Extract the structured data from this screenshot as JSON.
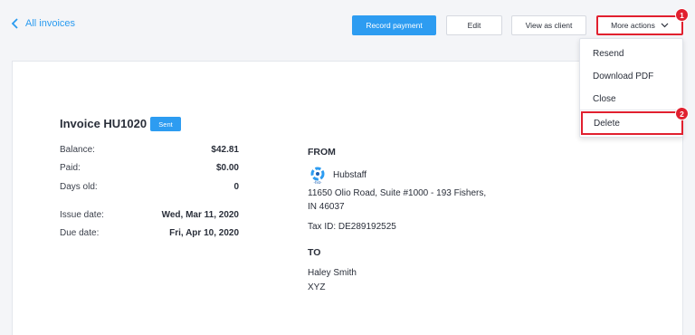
{
  "nav": {
    "back_label": "All invoices"
  },
  "toolbar": {
    "record_payment": "Record payment",
    "edit": "Edit",
    "view_as_client": "View as client",
    "more_actions": "More actions"
  },
  "annotations": {
    "badge_1": "1",
    "badge_2": "2"
  },
  "more_menu": {
    "items": [
      "Resend",
      "Download PDF",
      "Close",
      "Delete"
    ]
  },
  "invoice": {
    "title": "Invoice HU1020",
    "status": "Sent",
    "balance_label": "Balance:",
    "balance": "$42.81",
    "paid_label": "Paid:",
    "paid": "$0.00",
    "days_old_label": "Days old:",
    "days_old": "0",
    "issue_date_label": "Issue date:",
    "issue_date": "Wed, Mar 11, 2020",
    "due_date_label": "Due date:",
    "due_date": "Fri, Apr 10, 2020"
  },
  "from": {
    "heading": "FROM",
    "company": "Hubstaff",
    "logo_caption": "-hst-",
    "address_line1": "11650 Olio Road, Suite #1000 - 193 Fishers,",
    "address_line2": "IN 46037",
    "tax_id": "Tax ID: DE289192525"
  },
  "to": {
    "heading": "TO",
    "name": "Haley Smith",
    "company": "XYZ"
  },
  "colors": {
    "primary": "#2d9cf1",
    "highlight": "#e1202f",
    "link": "#2a9bf0"
  }
}
